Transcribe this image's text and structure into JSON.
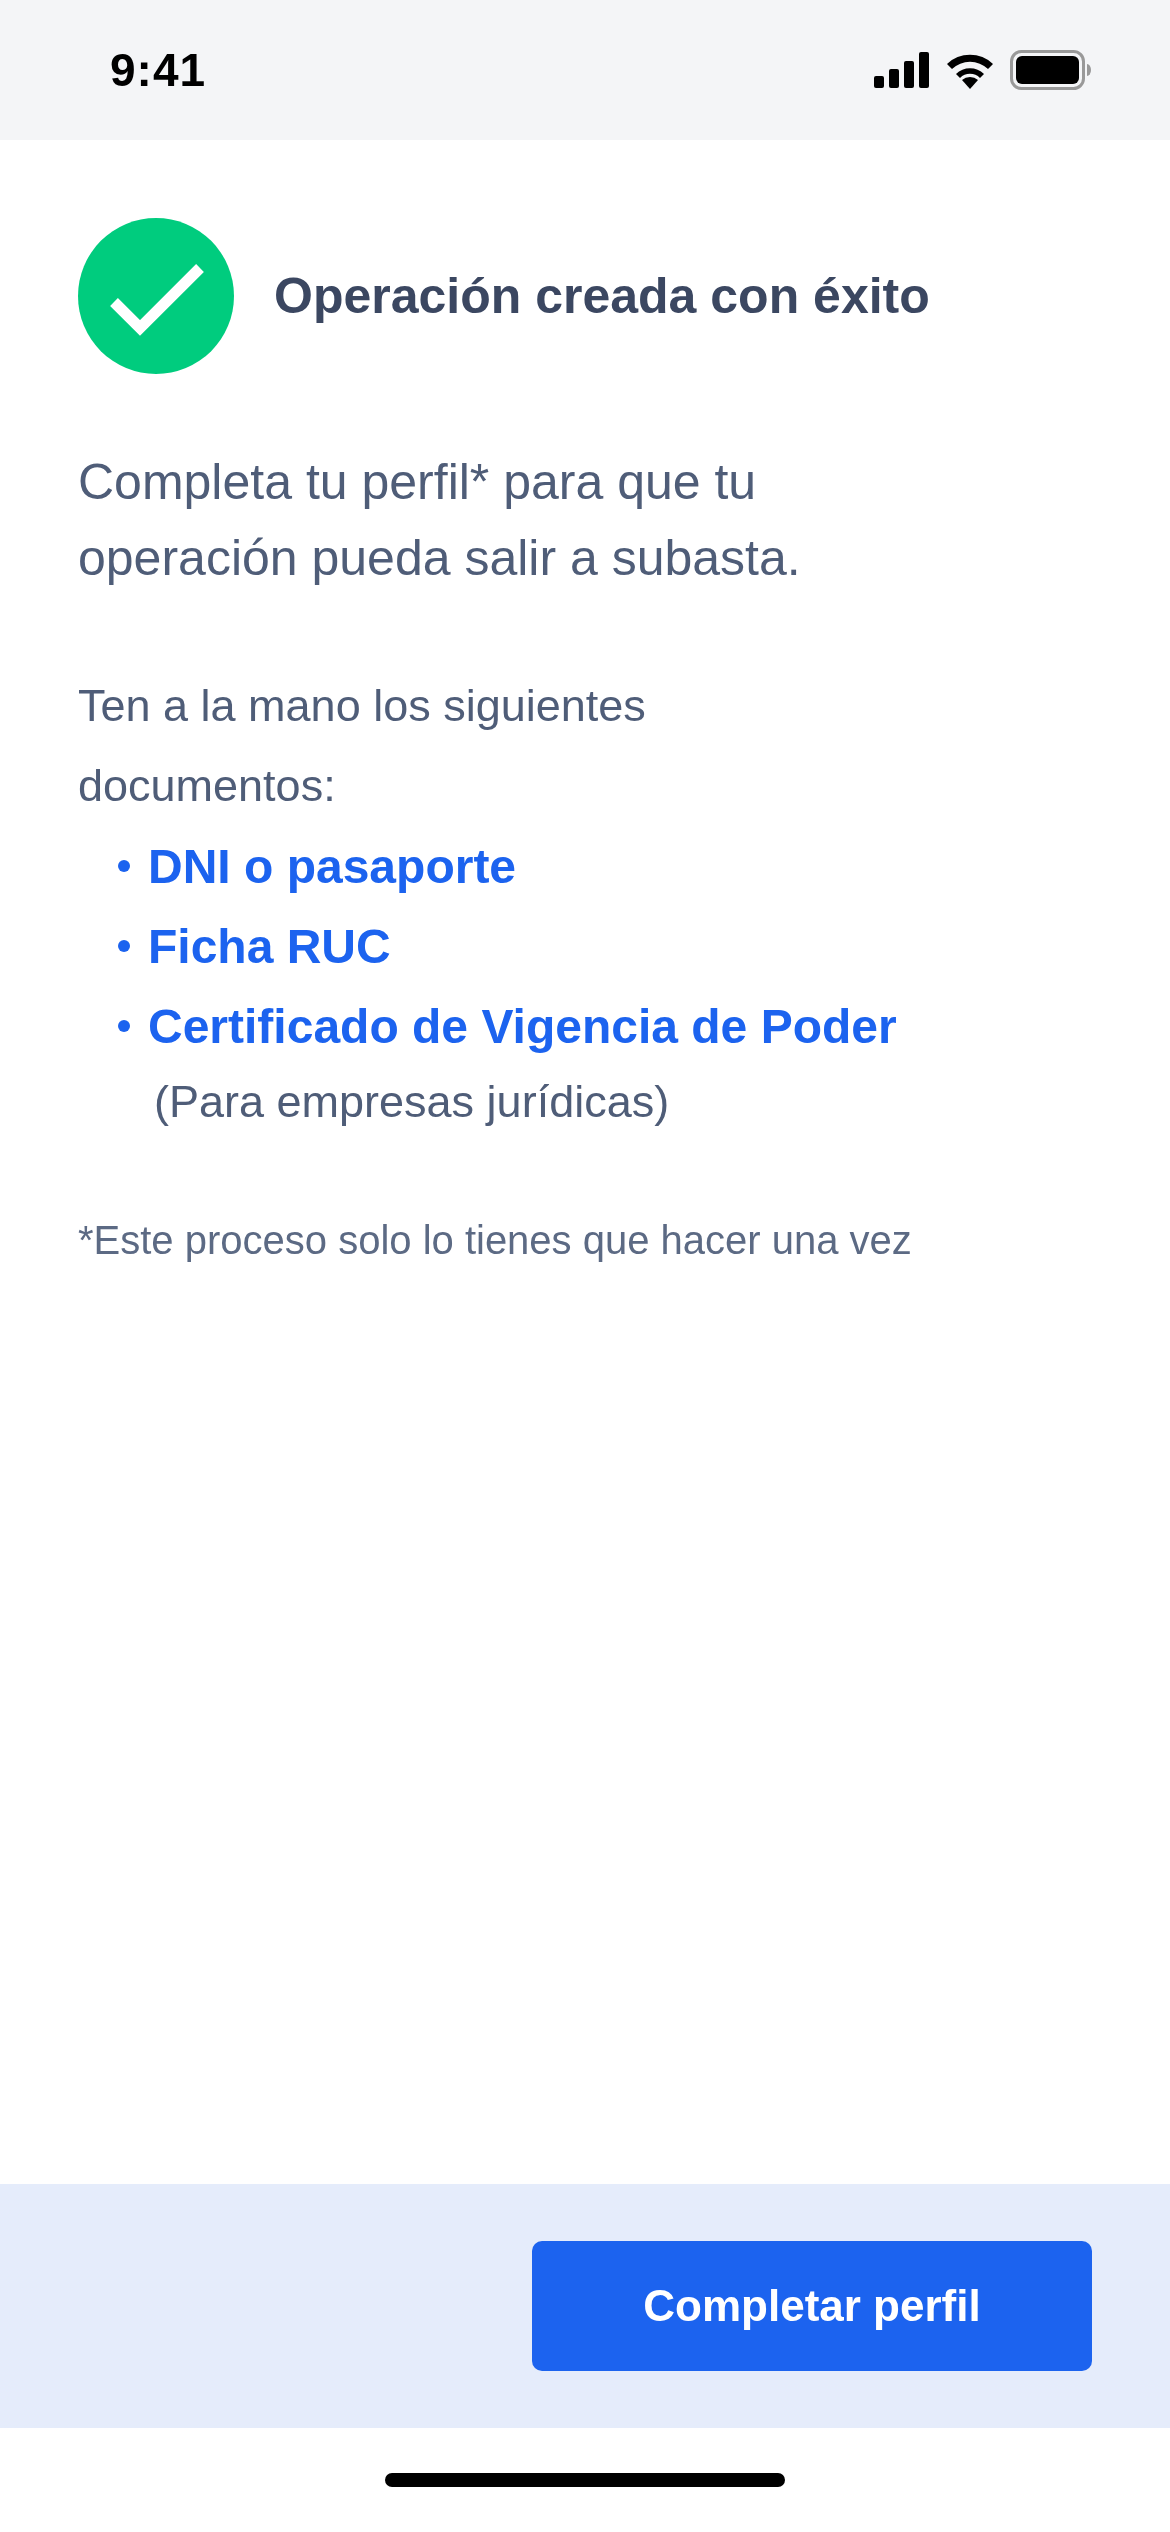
{
  "status_bar": {
    "time": "9:41"
  },
  "header": {
    "title": "Operación creada con éxito"
  },
  "intro": "Completa tu perfil* para que tu operación pueda salir a subasta.",
  "documents": {
    "lead": "Ten a la mano los siguientes documentos:",
    "items": [
      {
        "label": "DNI o pasaporte"
      },
      {
        "label": "Ficha RUC"
      },
      {
        "label": "Certificado de Vigencia de Poder",
        "note": "(Para empresas jurídicas)"
      }
    ]
  },
  "footnote": "*Este proceso solo lo tienes que hacer una vez",
  "footer": {
    "button": "Completar perfil"
  }
}
